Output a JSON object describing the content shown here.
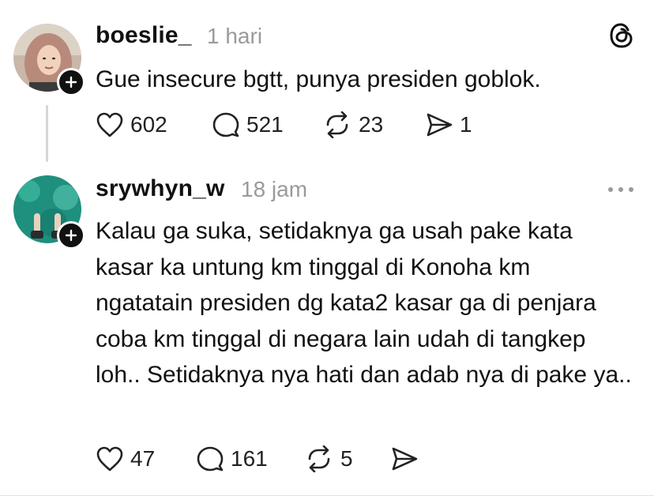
{
  "posts": [
    {
      "username": "boeslie_",
      "time": "1 hari",
      "text": "Gue insecure bgtt, punya presiden goblok.",
      "likes": "602",
      "replies": "521",
      "reposts": "23",
      "shares": "1",
      "top_right_icon": "threads-logo-icon"
    },
    {
      "username": "srywhyn_w",
      "time": "18 jam",
      "text": "Kalau ga suka, setidaknya ga usah pake kata kasar ka untung km tinggal di Konoha km ngatatain presiden dg kata2 kasar ga di penjara coba km tinggal di negara lain udah di tangkep loh.. Setidaknya nya hati dan adab nya di pake ya..",
      "likes": "47",
      "replies": "161",
      "reposts": "5",
      "shares": "",
      "top_right_icon": "more-options-icon"
    }
  ],
  "colors": {
    "text": "#111111",
    "muted": "#9a9a9a",
    "thread_line": "#d6d6d6"
  }
}
